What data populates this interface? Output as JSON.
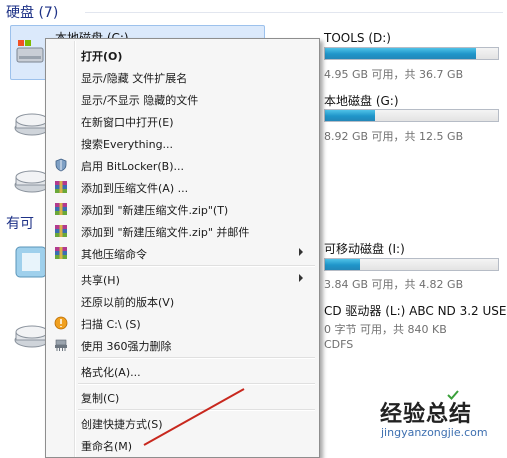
{
  "sections": {
    "hard_disks": "硬盘 (7)",
    "removable": "有可"
  },
  "drives_left": {
    "c_name": "本地磁盘 (C:)"
  },
  "drives_right": [
    {
      "name": "TOOLS (D:)",
      "info": "4.95 GB 可用，共 36.7 GB",
      "used_fraction": 0.87
    },
    {
      "name": "本地磁盘 (G:)",
      "info": "8.92 GB 可用，共 12.5 GB",
      "used_fraction": 0.29
    },
    {
      "name": "可移动磁盘 (I:)",
      "info": "3.84 GB 可用，共 4.82 GB",
      "used_fraction": 0.2
    },
    {
      "name": "CD 驱动器 (L:) ABC ND 3.2 USE",
      "info": "0 字节 可用，共 840 KB",
      "info2": "CDFS"
    }
  ],
  "menu": {
    "items": [
      {
        "label": "打开(O)",
        "bold": true
      },
      {
        "label": "显示/隐藏 文件扩展名"
      },
      {
        "label": "显示/不显示 隐藏的文件"
      },
      {
        "label": "在新窗口中打开(E)"
      },
      {
        "label": "搜索Everything..."
      },
      {
        "label": "启用 BitLocker(B)...",
        "icon": "shield-icon"
      },
      {
        "label": "添加到压缩文件(A) ...",
        "icon": "archive-icon"
      },
      {
        "label": "添加到 \"新建压缩文件.zip\"(T)",
        "icon": "archive-icon"
      },
      {
        "label": "添加到 \"新建压缩文件.zip\" 并邮件",
        "icon": "archive-icon"
      },
      {
        "label": "其他压缩命令",
        "icon": "archive-icon",
        "submenu": true
      },
      {
        "label": "共享(H)",
        "submenu": true
      },
      {
        "label": "还原以前的版本(V)"
      },
      {
        "label": "扫描 C:\\ (S)",
        "icon": "scan-icon"
      },
      {
        "label": "使用 360强力删除",
        "icon": "shredder-icon"
      },
      {
        "label": "格式化(A)..."
      },
      {
        "label": "复制(C)"
      },
      {
        "label": "创建快捷方式(S)"
      },
      {
        "label": "重命名(M)"
      }
    ]
  },
  "watermark": {
    "title": "经验总结",
    "url": "jingyanzongjie.com"
  },
  "colors": {
    "accent_bar": "#1f95c9",
    "section_header": "#1e3287",
    "watermark_url": "#3d6fb0"
  }
}
